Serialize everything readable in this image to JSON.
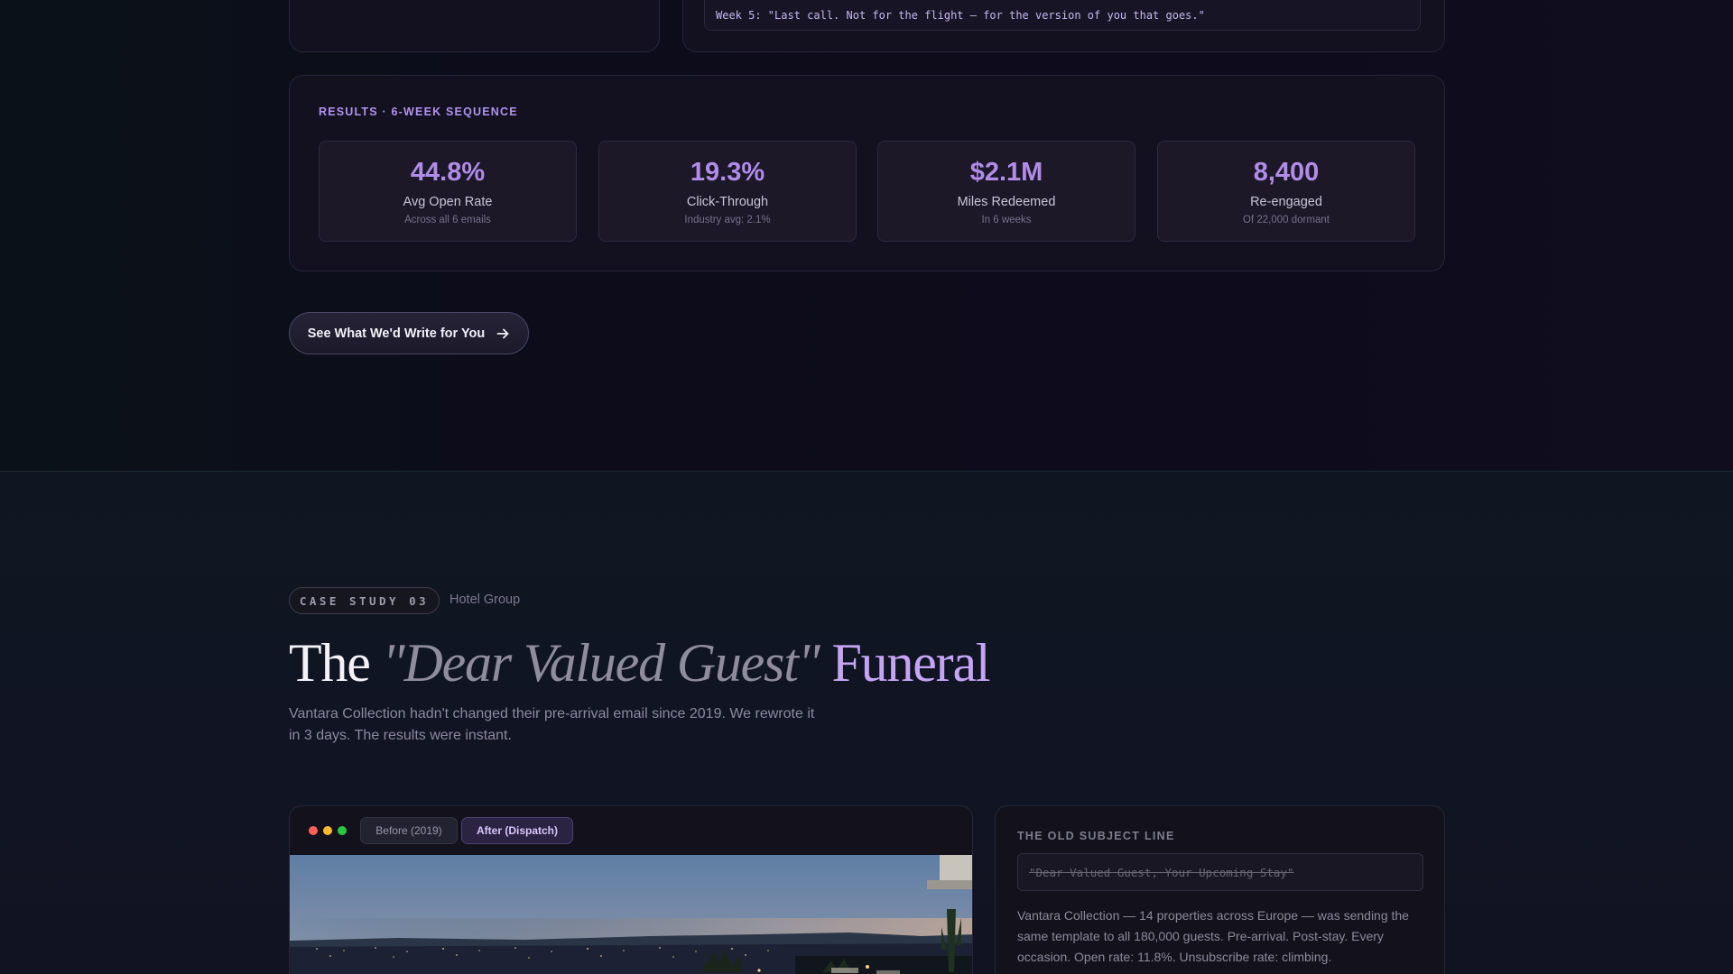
{
  "previous_case": {
    "week5_quote": "Week 5: \"Last call. Not for the flight — for the version of you that goes.\""
  },
  "results": {
    "title": "RESULTS · 6-WEEK SEQUENCE",
    "stats": [
      {
        "value": "44.8%",
        "label": "Avg Open Rate",
        "sub": "Across all 6 emails"
      },
      {
        "value": "19.3%",
        "label": "Click-Through",
        "sub": "Industry avg: 2.1%"
      },
      {
        "value": "$2.1M",
        "label": "Miles Redeemed",
        "sub": "In 6 weeks"
      },
      {
        "value": "8,400",
        "label": "Re-engaged",
        "sub": "Of 22,000 dormant"
      }
    ]
  },
  "cta": {
    "label": "See What We'd Write for You",
    "icon": "arrow-right-icon"
  },
  "case_study": {
    "badge": "CASE STUDY 03",
    "category": "Hotel Group",
    "headline": {
      "part1": "The ",
      "part2": "\"Dear Valued Guest\"",
      "part3": " Funeral"
    },
    "intro": "Vantara Collection hadn't changed their pre-arrival email since 2019. We rewrote it in 3 days. The results were instant.",
    "window_dots": [
      "#ff5f57",
      "#febc2e",
      "#28c840"
    ],
    "tabs": [
      {
        "label": "Before (2019)",
        "active": false
      },
      {
        "label": "After (Dispatch)",
        "active": true
      }
    ],
    "old_subject": {
      "title": "THE OLD SUBJECT LINE",
      "subject": "\"Dear Valued Guest, Your Upcoming Stay\"",
      "body": "Vantara Collection — 14 properties across Europe — was sending the same template to all 180,000 guests. Pre-arrival. Post-stay. Every occasion. Open rate: 11.8%. Unsubscribe rate: climbing."
    }
  },
  "colors": {
    "accent": "#b18ce8",
    "headline_accent": "#c6a4f4",
    "background": "#0d0c18"
  }
}
